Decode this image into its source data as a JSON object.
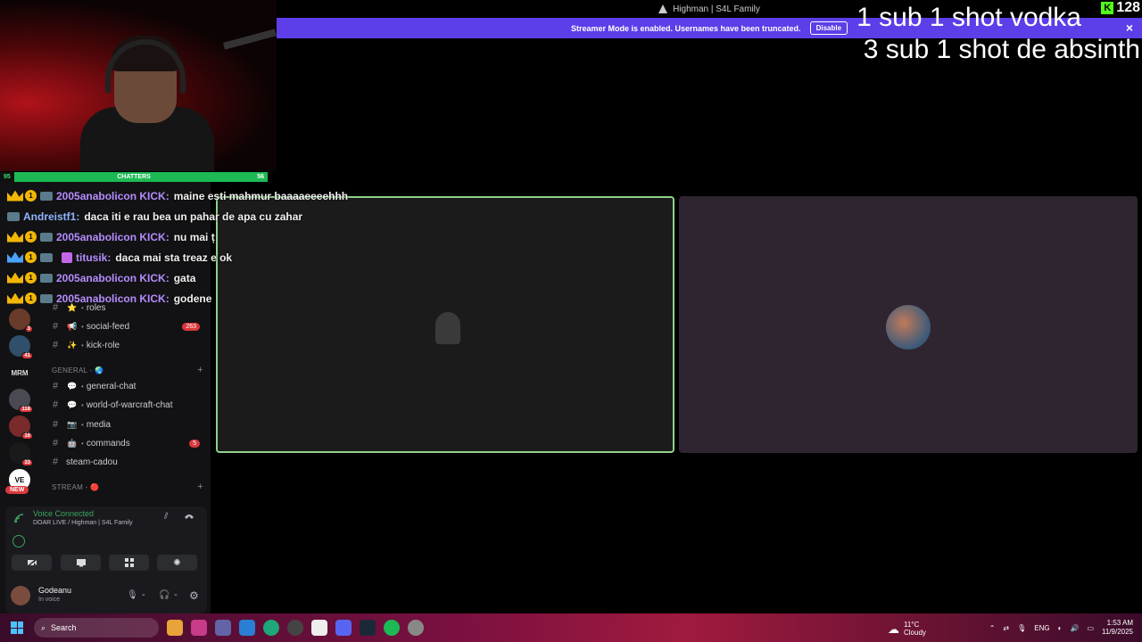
{
  "titlebar": {
    "title": "Highman | S4L Family"
  },
  "streamer_banner": {
    "text": "Streamer Mode is enabled. Usernames have been truncated.",
    "button": "Disable"
  },
  "overlay": {
    "line1": "1 sub 1 shot vodka",
    "line2": "3 sub 1 shot de absinth",
    "kick_count": "128"
  },
  "chatters_bar": {
    "left_count": "95",
    "label": "CHATTERS",
    "right_count": "56"
  },
  "servers": [
    {
      "label": "",
      "badge": "3"
    },
    {
      "label": "",
      "badge": "41"
    },
    {
      "label": "MRM",
      "badge": ""
    },
    {
      "label": "",
      "badge": "118"
    },
    {
      "label": "",
      "badge": "16"
    },
    {
      "label": "",
      "badge": "33"
    },
    {
      "label": "VE",
      "badge": ""
    }
  ],
  "new_badge": "NEW",
  "channels": {
    "roles": {
      "emoji": "⭐",
      "name": "roles"
    },
    "social_feed": {
      "emoji": "📢",
      "name": "social-feed",
      "count": "263"
    },
    "kick_role": {
      "emoji": "✨",
      "name": "kick-role"
    },
    "general_category": "GENERAL - 🌏",
    "general_chat": {
      "emoji": "💬",
      "name": "general-chat"
    },
    "wow_chat": {
      "emoji": "💬",
      "name": "world-of-warcraft-chat"
    },
    "media": {
      "emoji": "📷",
      "name": "media"
    },
    "commands": {
      "emoji": "🤖",
      "name": "commands",
      "count": "5"
    },
    "steam_cadou": {
      "name": "steam-cadou"
    },
    "stream_category": "STREAM - 🔴"
  },
  "voice": {
    "status": "Voice Connected",
    "channel": "DOAR LIVE / Highman | S4L Family",
    "username": "Godeanu",
    "user_status": "In voice"
  },
  "chat": [
    {
      "user": "2005anabolicon KICK:",
      "color": "purple",
      "message": "maine esti mahmur baaaaeeeehhh",
      "badges": true
    },
    {
      "user": "Andreistf1:",
      "color": "blue",
      "message": "daca iti e rau bea un pahar de apa cu zahar",
      "badges": false
    },
    {
      "user": "2005anabolicon KICK:",
      "color": "purple",
      "message": "nu mai ț",
      "badges": true
    },
    {
      "user": "titusik:",
      "color": "purple",
      "message": "daca mai sta treaz e ok",
      "badges": true,
      "gift": true
    },
    {
      "user": "2005anabolicon KICK:",
      "color": "purple",
      "message": "gata",
      "badges": true
    },
    {
      "user": "2005anabolicon KICK:",
      "color": "purple",
      "message": "godene",
      "badges": true
    }
  ],
  "taskbar": {
    "search": "Search",
    "weather_temp": "11°C",
    "weather_desc": "Cloudy",
    "lang": "ENG",
    "time": "1:53 AM",
    "date": "11/9/2025"
  }
}
